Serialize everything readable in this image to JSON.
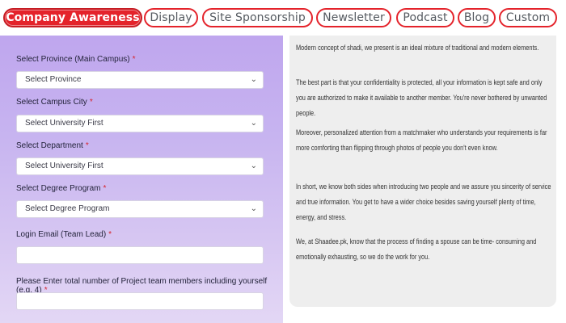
{
  "tabs": [
    {
      "label": "Company Awareness",
      "active": true
    },
    {
      "label": "Display",
      "active": false
    },
    {
      "label": "Site Sponsorship",
      "active": false
    },
    {
      "label": "Newsletter",
      "active": false
    },
    {
      "label": "Podcast",
      "active": false
    },
    {
      "label": "Blog",
      "active": false
    },
    {
      "label": "Custom",
      "active": false
    }
  ],
  "form": {
    "province": {
      "label": "Select Province (Main Campus)",
      "value": "Select Province"
    },
    "city": {
      "label": "Select Campus City",
      "value": "Select University First"
    },
    "department": {
      "label": "Select Department",
      "value": "Select University First"
    },
    "degree": {
      "label": "Select Degree Program",
      "value": "Select Degree Program"
    },
    "email": {
      "label": "Login Email (Team Lead)",
      "value": ""
    },
    "members": {
      "label": "Please Enter total number of Project team members including yourself (e.g. 4)",
      "value": ""
    },
    "required_mark": "*"
  },
  "article": {
    "paragraphs": [
      "Modern concept of shadi, we present is an ideal mixture of traditional and modern elements.",
      "The best part is that your confidentiality is protected, all your information is kept safe and only you are authorized to make it available to another member. You're never bothered by unwanted people.",
      "Moreover, personalized attention from a matchmaker who understands your requirements is far more comforting than flipping through photos of people you don't even know.",
      "In short, we know both sides when introducing two people and we assure you sincerity of service and true information. You get to have a wider choice besides saving yourself plenty of time, energy, and stress.",
      "We, at Shaadee.pk, know that the process of finding a spouse can be time- consuming and emotionally exhausting, so we do the work for you."
    ]
  },
  "colors": {
    "accent": "#e4232b",
    "panel_gradient_top": "#bfa6ee",
    "panel_gradient_bottom": "#e3d7f5",
    "article_bg": "#eeeeee"
  },
  "icons": {
    "select_arrow": "chevron-down-icon"
  }
}
